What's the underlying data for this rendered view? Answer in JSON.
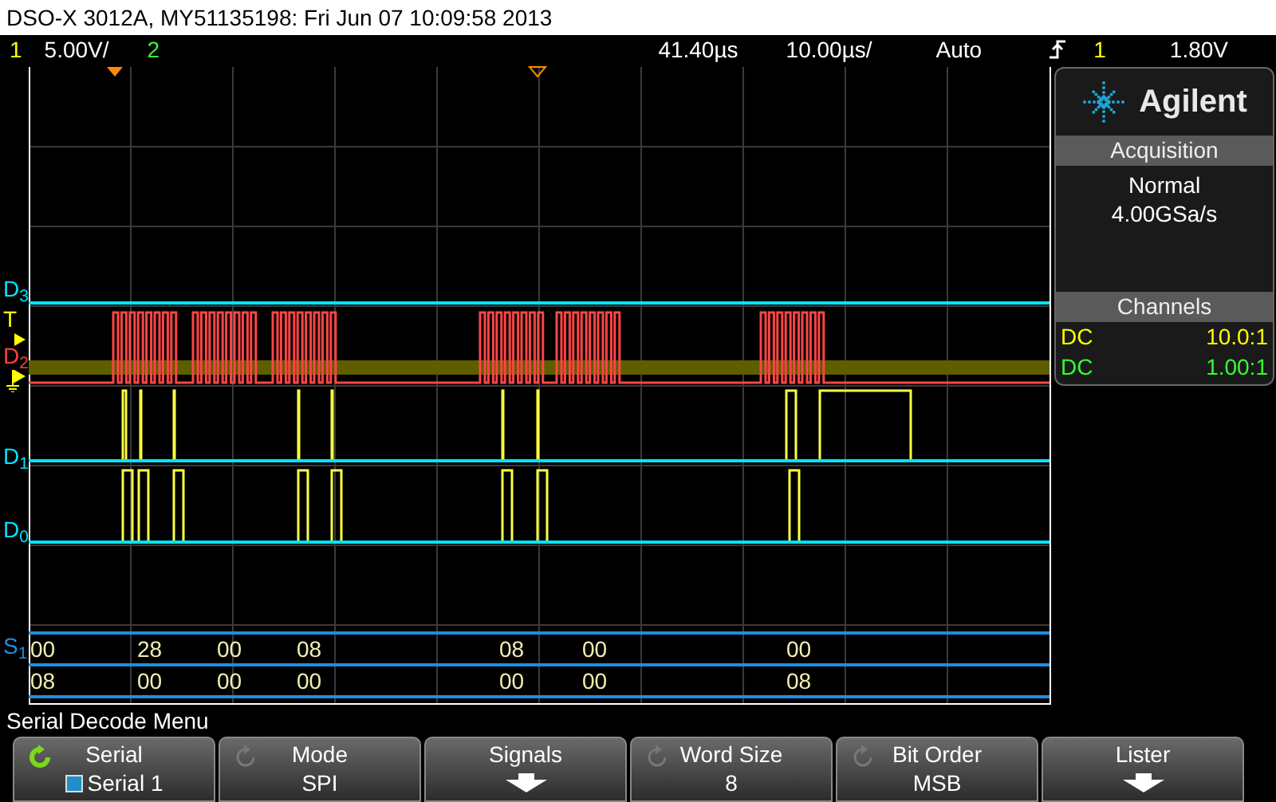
{
  "title": "DSO-X 3012A, MY51135198: Fri Jun 07 10:09:58 2013",
  "top_bar": {
    "channels": [
      {
        "number": "1",
        "scale": "5.00V/",
        "color": "#ffff00"
      },
      {
        "number": "2",
        "color": "#33ff33"
      }
    ],
    "delay": "41.40µs",
    "timebase": "10.00µs/",
    "trigger_mode": "Auto",
    "trigger_source": "1",
    "trigger_level": "1.80V"
  },
  "trace_labels": [
    {
      "text": "D$_{3}$",
      "color": "#00e5ff"
    },
    {
      "text": "T",
      "color": "#ffff00"
    },
    {
      "text": "D$_{2}$",
      "color": "#ff4040"
    },
    {
      "text": "D$_{1}$",
      "color": "#00e5ff"
    },
    {
      "text": "D$_{0}$",
      "color": "#00e5ff"
    }
  ],
  "decode": {
    "bus_label": "S$_{1}$",
    "rows": [
      [
        "00",
        "28",
        "00",
        "08",
        "08",
        "00",
        "00"
      ],
      [
        "08",
        "00",
        "00",
        "00",
        "00",
        "00",
        "08"
      ]
    ]
  },
  "panel": {
    "brand": "Agilent",
    "acquisition": {
      "title": "Acquisition",
      "mode": "Normal",
      "rate": "4.00GSa/s"
    },
    "channels": {
      "title": "Channels",
      "rows": [
        {
          "coupling": "DC",
          "probe": "10.0:1",
          "color": "#ffff00"
        },
        {
          "coupling": "DC",
          "probe": "1.00:1",
          "color": "#33ff33"
        }
      ]
    }
  },
  "menu_title": "Serial Decode Menu",
  "softkeys": [
    {
      "kind": "cycle",
      "label": "Serial",
      "value": "Serial 1",
      "active": true,
      "color": "#1e8fc8"
    },
    {
      "kind": "cycle",
      "label": "Mode",
      "value": "SPI",
      "active": false
    },
    {
      "kind": "submenu",
      "label": "Signals"
    },
    {
      "kind": "cycle",
      "label": "Word Size",
      "value": "8",
      "active": false
    },
    {
      "kind": "cycle",
      "label": "Bit Order",
      "value": "MSB",
      "active": false
    },
    {
      "kind": "submenu",
      "label": "Lister"
    }
  ]
}
